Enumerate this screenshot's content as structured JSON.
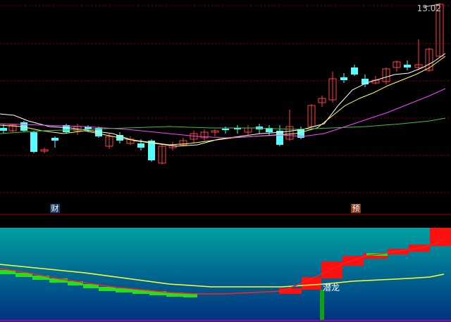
{
  "price_label": "13.02",
  "badges": [
    {
      "text": "财",
      "color": "#5aa0ff"
    },
    {
      "text": "预",
      "color": "#ff6a6a"
    }
  ],
  "signal_label": "潜龙",
  "colors": {
    "up": "#ff4040",
    "down": "#55ffff",
    "ma5": "#ffffff",
    "ma10": "#ffff60",
    "ma20": "#ff40ff",
    "ma60": "#40c040",
    "grid": "#8b0000",
    "indicator_top": "#00a0a0",
    "indicator_bottom": "#003080"
  }
}
